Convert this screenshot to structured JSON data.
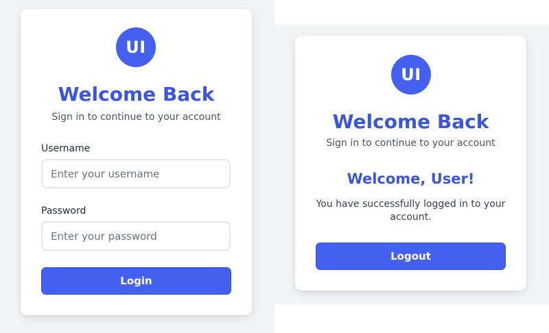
{
  "colors": {
    "accent": "#4361ee",
    "title": "#3a56e0",
    "page_background": "#f3f4f6",
    "card_background": "#ffffff"
  },
  "login_card": {
    "logo_text": "UI",
    "title": "Welcome Back",
    "subtitle": "Sign in to continue to your account",
    "username": {
      "label": "Username",
      "value": "",
      "placeholder": "Enter your username"
    },
    "password": {
      "label": "Password",
      "value": "",
      "placeholder": "Enter your password"
    },
    "login_button_label": "Login"
  },
  "welcome_card": {
    "logo_text": "UI",
    "title": "Welcome Back",
    "subtitle": "Sign in to continue to your account",
    "greeting": "Welcome, User!",
    "message": "You have successfully logged in to your account.",
    "logout_button_label": "Logout"
  }
}
